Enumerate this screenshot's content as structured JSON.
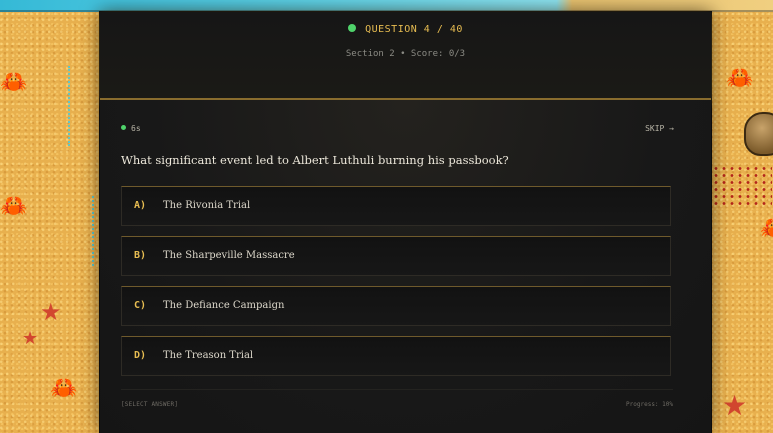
{
  "header": {
    "question_counter": "QUESTION 4 / 40",
    "section_line": "Section 2 • Score: 0/3"
  },
  "card": {
    "timer": "6s",
    "skip_label": "SKIP →",
    "question": "What significant event led to Albert Luthuli burning his passbook?",
    "options": [
      {
        "letter": "A)",
        "text": "The Rivonia Trial"
      },
      {
        "letter": "B)",
        "text": "The Sharpeville Massacre"
      },
      {
        "letter": "C)",
        "text": "The Defiance Campaign"
      },
      {
        "letter": "D)",
        "text": "The Treason Trial"
      }
    ]
  },
  "footer": {
    "status": "[SELECT ANSWER]",
    "progress": "Progress: 10%"
  },
  "colors": {
    "accent": "#e8bd52",
    "live_dot": "#4fd36b",
    "panel_bg": "#151515",
    "sand": "#e8b04e"
  },
  "icons": {
    "crab": "crab-icon",
    "starfish": "starfish-icon",
    "rock": "rock-icon"
  }
}
